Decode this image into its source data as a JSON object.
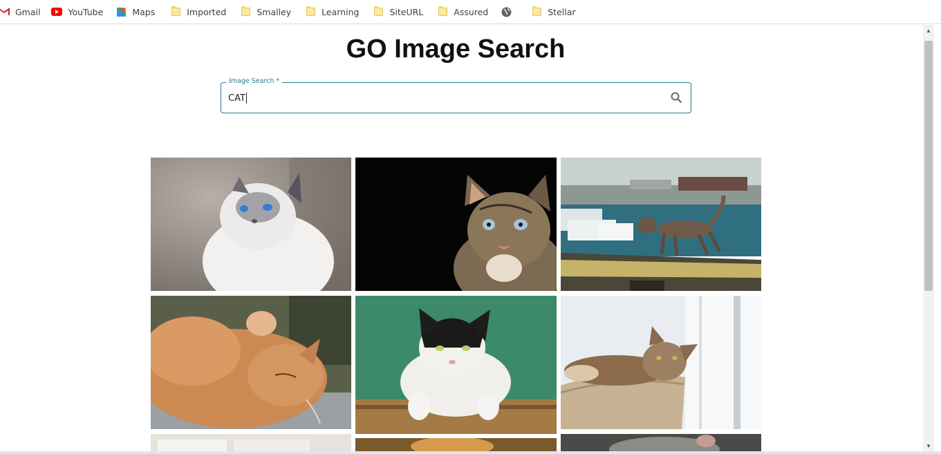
{
  "bookmarks": [
    {
      "label": "Gmail",
      "icon": "gmail-icon"
    },
    {
      "label": "YouTube",
      "icon": "youtube-icon"
    },
    {
      "label": "Maps",
      "icon": "maps-icon"
    },
    {
      "label": "Imported",
      "icon": "folder-icon"
    },
    {
      "label": "Smalley",
      "icon": "folder-icon"
    },
    {
      "label": "Learning",
      "icon": "folder-icon"
    },
    {
      "label": "SiteURL",
      "icon": "folder-icon"
    },
    {
      "label": "Assured",
      "icon": "folder-icon"
    },
    {
      "label": "",
      "icon": "globe-icon"
    },
    {
      "label": "Stellar",
      "icon": "folder-icon"
    }
  ],
  "page": {
    "title": "GO Image Search"
  },
  "search": {
    "label": "Image Search *",
    "value": "CAT",
    "icon": "search-icon"
  },
  "colors": {
    "accent": "#1f7a8c"
  },
  "results": [
    {
      "subject": "white cat with blue eyes looking up"
    },
    {
      "subject": "tabby cat on black background"
    },
    {
      "subject": "cat walking on harbor wall"
    },
    {
      "subject": "orange cat sleeping"
    },
    {
      "subject": "black and white cat on green background"
    },
    {
      "subject": "tabby cat in basket by window"
    },
    {
      "subject": "partially visible image"
    },
    {
      "subject": "partially visible image"
    },
    {
      "subject": "partially visible image"
    }
  ]
}
